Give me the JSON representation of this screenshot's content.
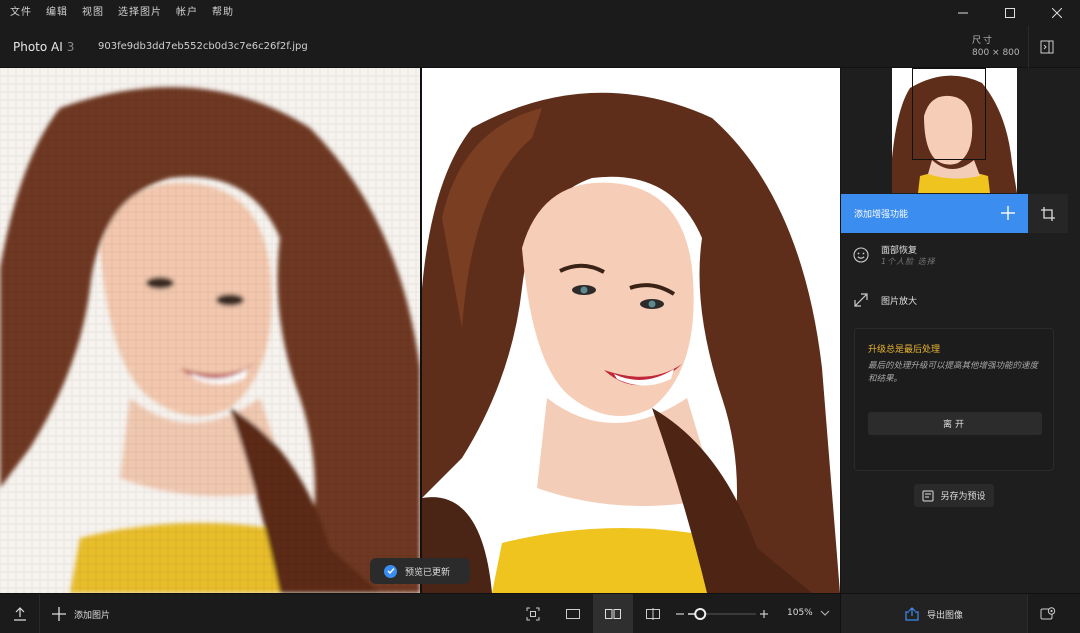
{
  "menu": [
    "文件",
    "编辑",
    "视图",
    "选择图片",
    "帐户",
    "帮助"
  ],
  "app": {
    "name": "Photo AI",
    "version": "3"
  },
  "file": {
    "name": "903fe9db3dd7eb552cb0d3c7e6c26f2f.jpg"
  },
  "dimensions": {
    "label": "尺寸",
    "value": "800 × 800"
  },
  "toast": {
    "text": "预览已更新"
  },
  "sidebar": {
    "add_feature_label": "添加增强功能",
    "features": [
      {
        "title": "面部恢复",
        "subtitle": "1个人脸 选择",
        "icon": "face-icon"
      },
      {
        "title": "图片放大",
        "subtitle": "",
        "icon": "expand-icon"
      }
    ],
    "upgrade": {
      "title": "升级总是最后处理",
      "description": "最后的处理升级可以提高其他增强功能的速度和结果。",
      "button": "离开"
    },
    "save_preset": "另存为预设"
  },
  "bottom": {
    "add_image": "添加图片",
    "zoom": "105%",
    "zoom_level": 0.18,
    "export": "导出图像"
  },
  "colors": {
    "accent": "#3c8df0",
    "warning": "#e9b534"
  }
}
